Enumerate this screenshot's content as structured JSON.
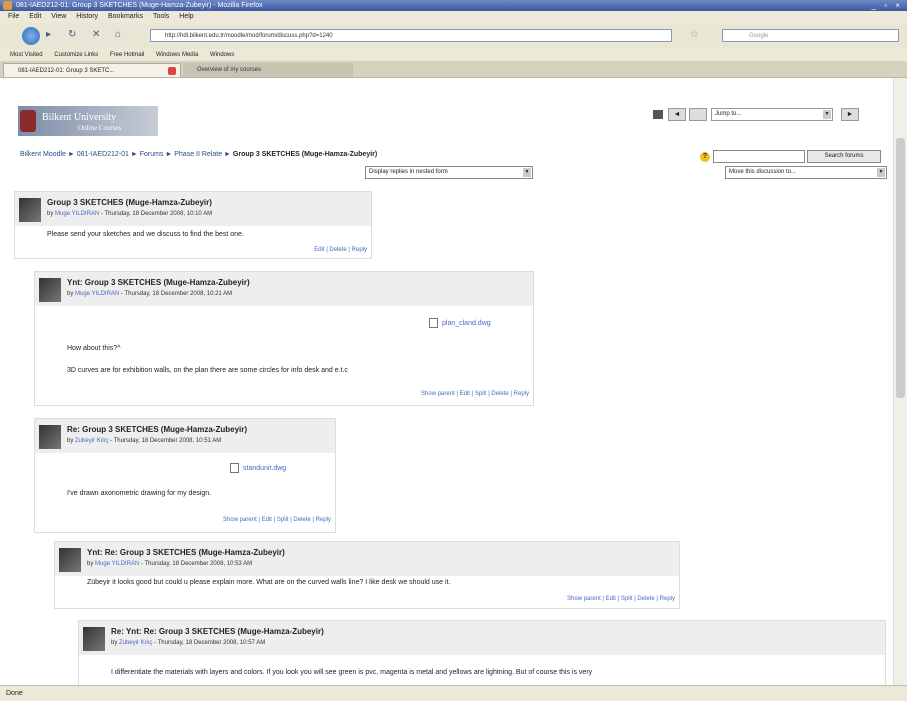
{
  "window": {
    "title": "081-IAED212-01: Group 3 SKETCHES (Muge-Hamza-Zubeyir) - Mozilla Firefox",
    "controls": "_ ▫ ×"
  },
  "menu": [
    "File",
    "Edit",
    "View",
    "History",
    "Bookmarks",
    "Tools",
    "Help"
  ],
  "address": {
    "url": "http://hdl.bilkent.edu.tr/moodle/mod/forum/discuss.php?d=1240",
    "search_placeholder": "Google"
  },
  "bookmarks": [
    "Most Visited",
    "Customize Links",
    "Free Hotmail",
    "Windows Media",
    "Windows"
  ],
  "tabs": [
    {
      "label": "081-IAED212-01: Group 3 SKETC..."
    },
    {
      "label": "Overview of my courses"
    }
  ],
  "logo": {
    "line1": "Bilkent University",
    "line2": "Online Courses"
  },
  "jump": {
    "label": "Jump to...",
    "prev": "◄",
    "next": "►"
  },
  "breadcrumb": {
    "trail": "Bilkent Moodle ► 081-IAED212-01 ► Forums ► Phase II Relate ► ",
    "current": "Group 3 SKETCHES (Muge-Hamza-Zubeyir)"
  },
  "controls": {
    "display_mode": "Display replies in nested form",
    "move": "Move this discussion to...",
    "search_button": "Search forums",
    "help": "?"
  },
  "posts": [
    {
      "subject": "Group 3 SKETCHES (Muge-Hamza-Zubeyir)",
      "author": "Muge YILDIRAN",
      "date": " - Thursday, 18 December 2008, 10:10 AM",
      "body": [
        "Please send your sketches and we discuss to find the best one."
      ],
      "commands": "Edit | Delete | Reply"
    },
    {
      "subject": "Ynt: Group 3 SKETCHES (Muge-Hamza-Zubeyir)",
      "author": "Muge YILDIRAN",
      "date": " - Thursday, 18 December 2008, 10:21 AM",
      "attachment": "plan_cland.dwg",
      "body": [
        "How about this?^",
        "3D curves are for exhibition walls, on the plan there are some circles for info desk and e.t.c"
      ],
      "commands": "Show parent | Edit | Split | Delete | Reply"
    },
    {
      "subject": "Re: Group 3 SKETCHES (Muge-Hamza-Zubeyir)",
      "author": "Zubeyir Kılıç",
      "date": " - Thursday, 18 December 2008, 10:51 AM",
      "attachment": "standunit.dwg",
      "body": [
        "I've drawn axonometric drawing for my design."
      ],
      "commands": "Show parent | Edit | Split | Delete | Reply"
    },
    {
      "subject": "Ynt: Re: Group 3 SKETCHES (Muge-Hamza-Zubeyir)",
      "author": "Muge YILDIRAN",
      "date": " - Thursday, 18 December 2008, 10:53 AM",
      "body": [
        "Zübeyir it looks good but could u please explain more. What are on the curved walls line? I like desk we should use it."
      ],
      "commands": "Show parent | Edit | Split | Delete | Reply"
    },
    {
      "subject": "Re: Ynt: Re: Group 3 SKETCHES (Muge-Hamza-Zubeyir)",
      "author": "Zubeyir Kılıç",
      "date": " - Thursday, 18 December 2008, 10:57 AM",
      "body": [
        "I differentiate the materials with layers and colors. If you look you will see green is pvc, magenta is metal and yellows are lightning.  But of course this is very"
      ]
    }
  ],
  "status": "Done"
}
